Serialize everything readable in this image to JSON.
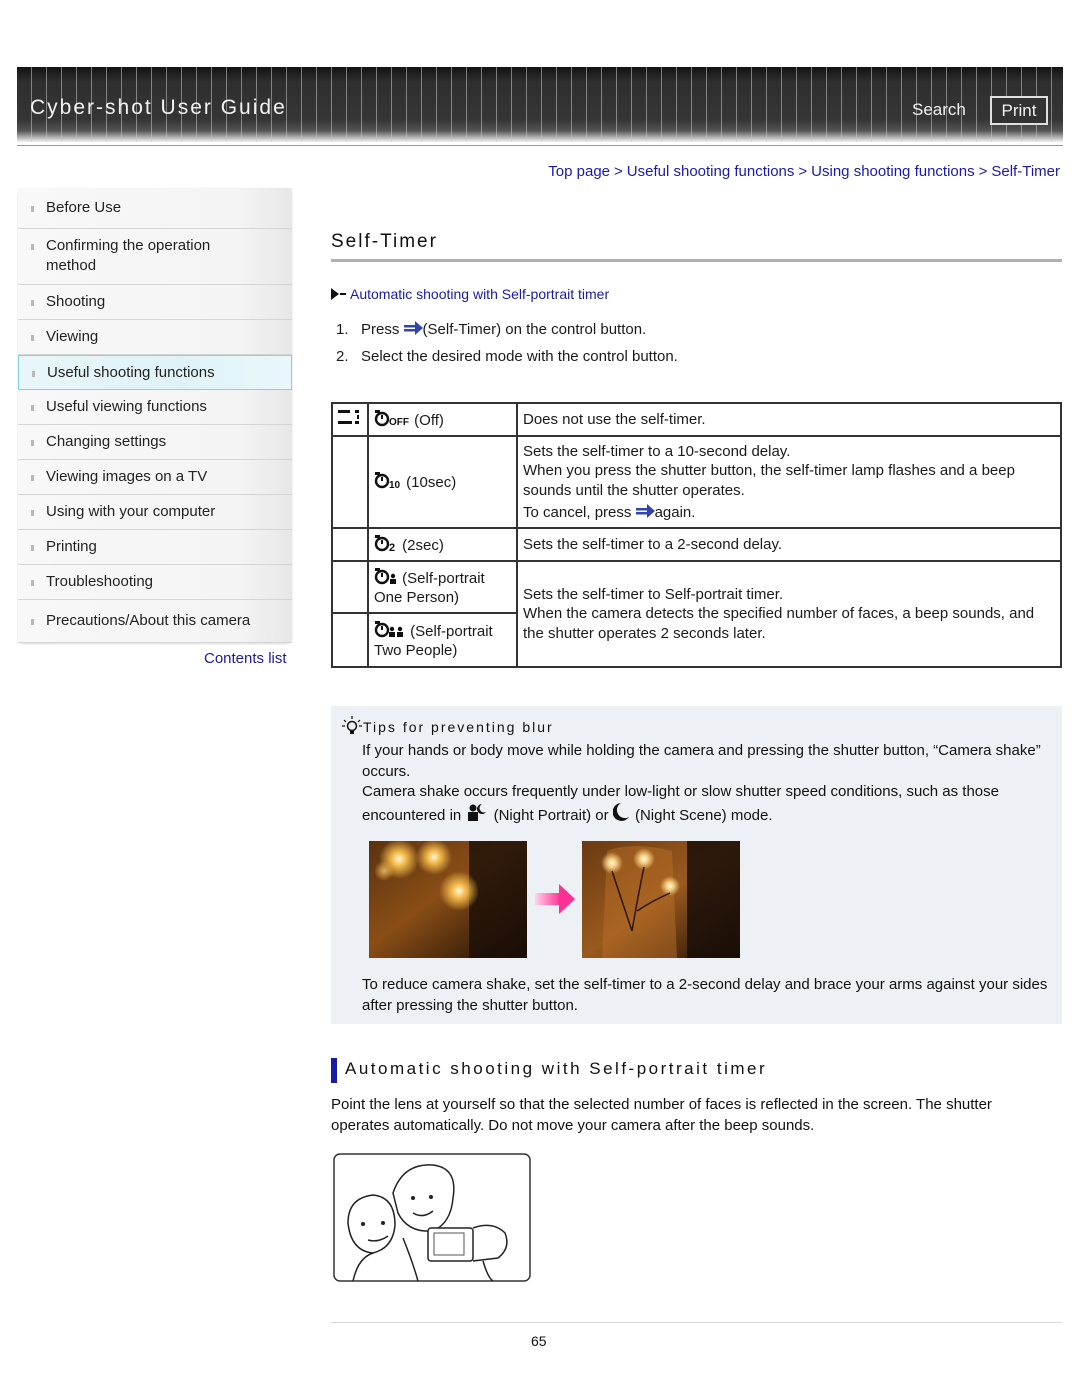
{
  "header": {
    "title": "Cyber-shot User Guide",
    "search_label": "Search",
    "print_label": "Print"
  },
  "sidebar": {
    "items": [
      {
        "label": "Before Use",
        "active": false
      },
      {
        "label": "Confirming the operation method",
        "active": false
      },
      {
        "label": "Shooting",
        "active": false
      },
      {
        "label": "Viewing",
        "active": false
      },
      {
        "label": "Useful shooting functions",
        "active": true
      },
      {
        "label": "Useful viewing functions",
        "active": false
      },
      {
        "label": "Changing settings",
        "active": false
      },
      {
        "label": "Viewing images on a TV",
        "active": false
      },
      {
        "label": "Using with your computer",
        "active": false
      },
      {
        "label": "Printing",
        "active": false
      },
      {
        "label": "Troubleshooting",
        "active": false
      },
      {
        "label": "Precautions/About this camera",
        "active": false
      }
    ],
    "contents_link": "Contents list"
  },
  "breadcrumb": {
    "items": [
      "Top page",
      "Useful shooting functions",
      "Using shooting functions",
      "Self-Timer"
    ],
    "separator": ">"
  },
  "page": {
    "title": "Self-Timer",
    "anchor_link": "Automatic shooting with Self-portrait timer",
    "steps": [
      {
        "num": "1.",
        "before": "Press",
        "icon": "self-timer-arrow-icon",
        "after": "(Self-Timer) on the control button."
      },
      {
        "num": "2.",
        "text": "Select the desired mode with the control button."
      }
    ]
  },
  "modes_table": {
    "rows": [
      {
        "icon": "timer-off-icon",
        "label": "(Off)",
        "desc": [
          "Does not use the self-timer."
        ]
      },
      {
        "icon": "timer-10sec-icon",
        "label": "(10sec)",
        "desc": [
          "Sets the self-timer to a 10-second delay.",
          "When you press the shutter button, the self-timer lamp flashes and a beep sounds until the shutter operates."
        ],
        "cancel_before": "To cancel, press",
        "cancel_after": "again."
      },
      {
        "icon": "timer-2sec-icon",
        "label": "(2sec)",
        "desc": [
          "Sets the self-timer to a 2-second delay."
        ]
      },
      {
        "icon": "self-portrait-one-icon",
        "label": "(Self-portrait One Person)"
      },
      {
        "icon": "self-portrait-two-icon",
        "label": "(Self-portrait Two People)"
      }
    ],
    "self_portrait_desc": [
      "Sets the self-timer to Self-portrait timer.",
      "When the camera detects the specified number of faces, a beep sounds, and the shutter operates 2 seconds later."
    ]
  },
  "tips": {
    "heading": "Tips for preventing blur",
    "para1": "If your hands or body move while holding the camera and pressing the shutter button, “Camera shake” occurs.",
    "para2_before": "Camera shake occurs frequently under low-light or slow shutter speed conditions, such as those encountered in",
    "night_portrait": "(Night Portrait) or",
    "night_scene": "(Night Scene) mode.",
    "images": [
      "blurred-night-photo",
      "sharp-night-photo"
    ],
    "para3": "To reduce camera shake, set the self-timer to a 2-second delay and brace your arms against your sides after pressing the shutter button."
  },
  "section2": {
    "heading": "Automatic shooting with Self-portrait timer",
    "text": "Point the lens at yourself so that the selected number of faces is reflected in the screen. The shutter operates automatically. Do not move your camera after the beep sounds.",
    "illustration": "self-portrait-illustration"
  },
  "footer": {
    "page_number": "65"
  },
  "colors": {
    "link": "#1a1aa6",
    "active_nav": "#dff3f7",
    "tips_bg": "#edf0f4",
    "arrow_blue": "#3344aa",
    "pink_arrow": "#ff3d9a"
  }
}
